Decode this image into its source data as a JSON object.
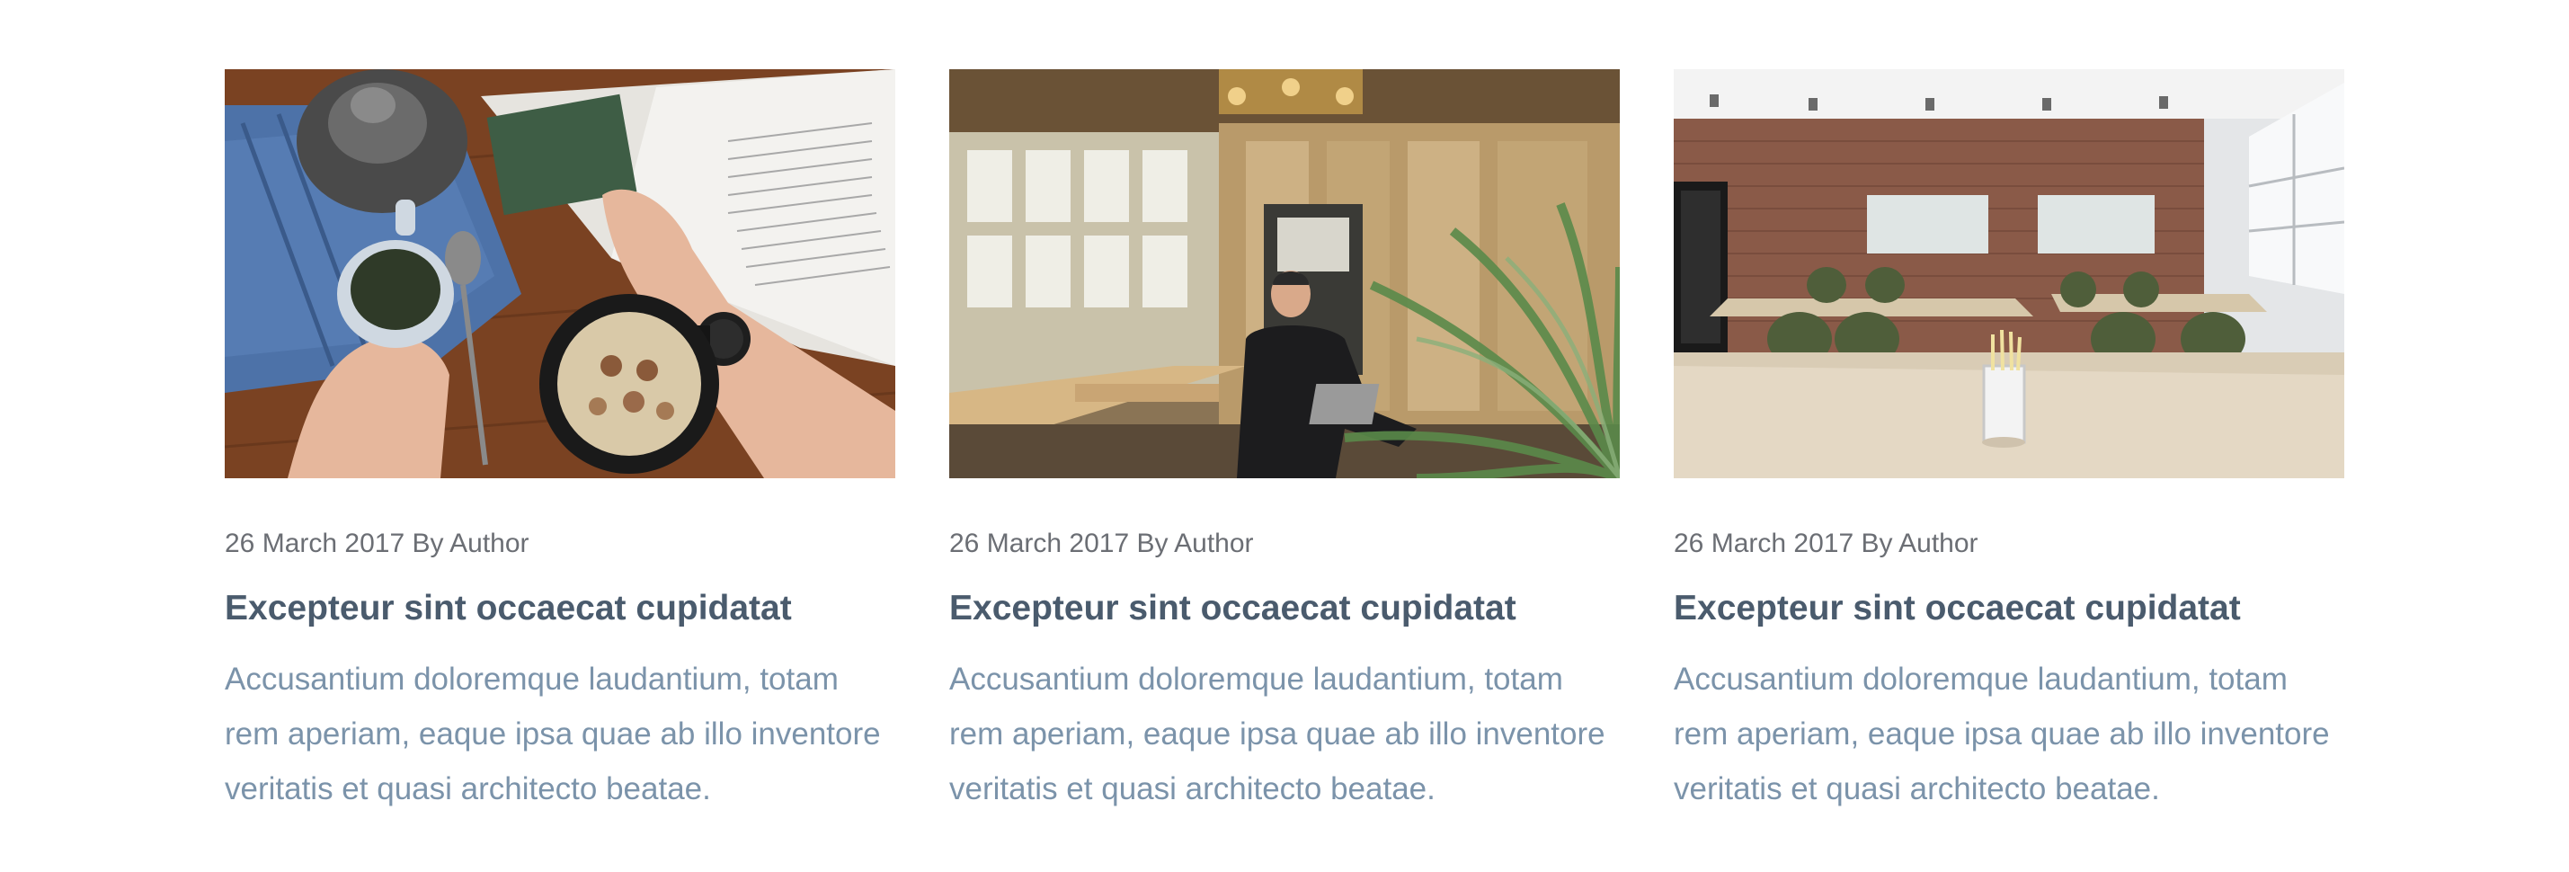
{
  "posts": [
    {
      "image": "breakfast-photo",
      "meta": "26 March 2017 By Author",
      "title": "Excepteur sint occaecat cupidatat",
      "excerpt": "Accusantium doloremque laudantium, totam rem aperiam, eaque ipsa quae ab illo inventore veritatis et quasi architecto beatae."
    },
    {
      "image": "cafe-interior-photo",
      "meta": "26 March 2017 By Author",
      "title": "Excepteur sint occaecat cupidatat",
      "excerpt": "Accusantium doloremque laudantium, totam rem aperiam, eaque ipsa quae ab illo inventore veritatis et quasi architecto beatae."
    },
    {
      "image": "meeting-room-photo",
      "meta": "26 March 2017 By Author",
      "title": "Excepteur sint occaecat cupidatat",
      "excerpt": "Accusantium doloremque laudantium, totam rem aperiam, eaque ipsa quae ab illo inventore veritatis et quasi architecto beatae."
    }
  ],
  "colors": {
    "meta_text": "#6b6e74",
    "title_text": "#4a5b6d",
    "excerpt_text": "#7b93aa",
    "background": "#ffffff"
  }
}
